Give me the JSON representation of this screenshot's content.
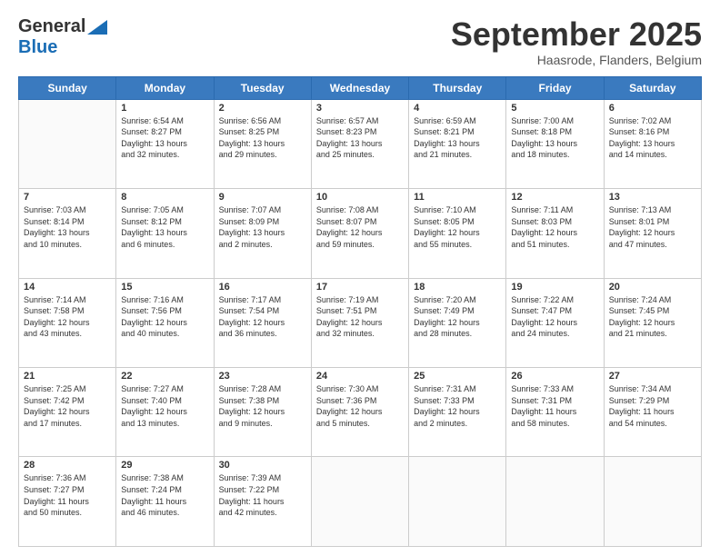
{
  "header": {
    "logo_general": "General",
    "logo_blue": "Blue",
    "month_title": "September 2025",
    "location": "Haasrode, Flanders, Belgium"
  },
  "days_of_week": [
    "Sunday",
    "Monday",
    "Tuesday",
    "Wednesday",
    "Thursday",
    "Friday",
    "Saturday"
  ],
  "weeks": [
    [
      {
        "day": "",
        "info": ""
      },
      {
        "day": "1",
        "info": "Sunrise: 6:54 AM\nSunset: 8:27 PM\nDaylight: 13 hours\nand 32 minutes."
      },
      {
        "day": "2",
        "info": "Sunrise: 6:56 AM\nSunset: 8:25 PM\nDaylight: 13 hours\nand 29 minutes."
      },
      {
        "day": "3",
        "info": "Sunrise: 6:57 AM\nSunset: 8:23 PM\nDaylight: 13 hours\nand 25 minutes."
      },
      {
        "day": "4",
        "info": "Sunrise: 6:59 AM\nSunset: 8:21 PM\nDaylight: 13 hours\nand 21 minutes."
      },
      {
        "day": "5",
        "info": "Sunrise: 7:00 AM\nSunset: 8:18 PM\nDaylight: 13 hours\nand 18 minutes."
      },
      {
        "day": "6",
        "info": "Sunrise: 7:02 AM\nSunset: 8:16 PM\nDaylight: 13 hours\nand 14 minutes."
      }
    ],
    [
      {
        "day": "7",
        "info": "Sunrise: 7:03 AM\nSunset: 8:14 PM\nDaylight: 13 hours\nand 10 minutes."
      },
      {
        "day": "8",
        "info": "Sunrise: 7:05 AM\nSunset: 8:12 PM\nDaylight: 13 hours\nand 6 minutes."
      },
      {
        "day": "9",
        "info": "Sunrise: 7:07 AM\nSunset: 8:09 PM\nDaylight: 13 hours\nand 2 minutes."
      },
      {
        "day": "10",
        "info": "Sunrise: 7:08 AM\nSunset: 8:07 PM\nDaylight: 12 hours\nand 59 minutes."
      },
      {
        "day": "11",
        "info": "Sunrise: 7:10 AM\nSunset: 8:05 PM\nDaylight: 12 hours\nand 55 minutes."
      },
      {
        "day": "12",
        "info": "Sunrise: 7:11 AM\nSunset: 8:03 PM\nDaylight: 12 hours\nand 51 minutes."
      },
      {
        "day": "13",
        "info": "Sunrise: 7:13 AM\nSunset: 8:01 PM\nDaylight: 12 hours\nand 47 minutes."
      }
    ],
    [
      {
        "day": "14",
        "info": "Sunrise: 7:14 AM\nSunset: 7:58 PM\nDaylight: 12 hours\nand 43 minutes."
      },
      {
        "day": "15",
        "info": "Sunrise: 7:16 AM\nSunset: 7:56 PM\nDaylight: 12 hours\nand 40 minutes."
      },
      {
        "day": "16",
        "info": "Sunrise: 7:17 AM\nSunset: 7:54 PM\nDaylight: 12 hours\nand 36 minutes."
      },
      {
        "day": "17",
        "info": "Sunrise: 7:19 AM\nSunset: 7:51 PM\nDaylight: 12 hours\nand 32 minutes."
      },
      {
        "day": "18",
        "info": "Sunrise: 7:20 AM\nSunset: 7:49 PM\nDaylight: 12 hours\nand 28 minutes."
      },
      {
        "day": "19",
        "info": "Sunrise: 7:22 AM\nSunset: 7:47 PM\nDaylight: 12 hours\nand 24 minutes."
      },
      {
        "day": "20",
        "info": "Sunrise: 7:24 AM\nSunset: 7:45 PM\nDaylight: 12 hours\nand 21 minutes."
      }
    ],
    [
      {
        "day": "21",
        "info": "Sunrise: 7:25 AM\nSunset: 7:42 PM\nDaylight: 12 hours\nand 17 minutes."
      },
      {
        "day": "22",
        "info": "Sunrise: 7:27 AM\nSunset: 7:40 PM\nDaylight: 12 hours\nand 13 minutes."
      },
      {
        "day": "23",
        "info": "Sunrise: 7:28 AM\nSunset: 7:38 PM\nDaylight: 12 hours\nand 9 minutes."
      },
      {
        "day": "24",
        "info": "Sunrise: 7:30 AM\nSunset: 7:36 PM\nDaylight: 12 hours\nand 5 minutes."
      },
      {
        "day": "25",
        "info": "Sunrise: 7:31 AM\nSunset: 7:33 PM\nDaylight: 12 hours\nand 2 minutes."
      },
      {
        "day": "26",
        "info": "Sunrise: 7:33 AM\nSunset: 7:31 PM\nDaylight: 11 hours\nand 58 minutes."
      },
      {
        "day": "27",
        "info": "Sunrise: 7:34 AM\nSunset: 7:29 PM\nDaylight: 11 hours\nand 54 minutes."
      }
    ],
    [
      {
        "day": "28",
        "info": "Sunrise: 7:36 AM\nSunset: 7:27 PM\nDaylight: 11 hours\nand 50 minutes."
      },
      {
        "day": "29",
        "info": "Sunrise: 7:38 AM\nSunset: 7:24 PM\nDaylight: 11 hours\nand 46 minutes."
      },
      {
        "day": "30",
        "info": "Sunrise: 7:39 AM\nSunset: 7:22 PM\nDaylight: 11 hours\nand 42 minutes."
      },
      {
        "day": "",
        "info": ""
      },
      {
        "day": "",
        "info": ""
      },
      {
        "day": "",
        "info": ""
      },
      {
        "day": "",
        "info": ""
      }
    ]
  ]
}
